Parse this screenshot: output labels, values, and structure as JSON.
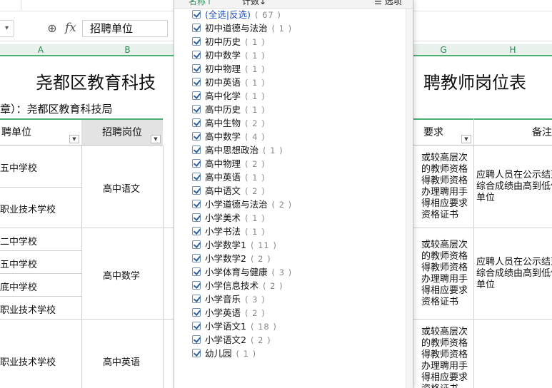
{
  "formula_bar": {
    "cell_value": "招聘单位",
    "fx_label": "fx"
  },
  "columns": [
    "A",
    "B",
    "G",
    "H"
  ],
  "sheet": {
    "title_left": "尧都区教育科技",
    "title_right": "聘教师岗位表",
    "subtitle": "章）：尧都区教育科技局",
    "headers": {
      "unit": "聘单位",
      "position": "招聘岗位",
      "requirements": "要求",
      "notes": "备注"
    },
    "rows": [
      {
        "units": [
          "五中学校",
          "职业技术学校"
        ],
        "position": "高中语文"
      },
      {
        "units": [
          "二中学校",
          "五中学校",
          "底中学校",
          "职业技术学校"
        ],
        "position": "高中数学"
      },
      {
        "units": [
          "职业技术学校"
        ],
        "position": "高中英语"
      }
    ],
    "requirement_text": "或较高层次\n的教师资格\n得教师资格\n办理聘用手\n得相应要求\n资格证书",
    "requirement_text_3": "或较高层次\n的教师资格\n得教师资格\n办理聘用手\n得相应要求\n资格证书",
    "notes_text": "应聘人员在公示结束\n综合成绩由高到低依\n单位"
  },
  "filter_popup": {
    "header_left": "名称↑",
    "header_mid": "计数↓",
    "header_right": "选项",
    "select_all_label": "(全选|反选)",
    "select_all_count": "( 67 )",
    "items": [
      {
        "label": "初中道德与法治",
        "count": "( 1 )"
      },
      {
        "label": "初中历史",
        "count": "( 1 )"
      },
      {
        "label": "初中数学",
        "count": "( 1 )"
      },
      {
        "label": "初中物理",
        "count": "( 1 )"
      },
      {
        "label": "初中英语",
        "count": "( 1 )"
      },
      {
        "label": "高中化学",
        "count": "( 1 )"
      },
      {
        "label": "高中历史",
        "count": "( 1 )"
      },
      {
        "label": "高中生物",
        "count": "( 2 )"
      },
      {
        "label": "高中数学",
        "count": "( 4 )"
      },
      {
        "label": "高中思想政治",
        "count": "( 1 )"
      },
      {
        "label": "高中物理",
        "count": "( 2 )"
      },
      {
        "label": "高中英语",
        "count": "( 1 )"
      },
      {
        "label": "高中语文",
        "count": "( 2 )"
      },
      {
        "label": "小学道德与法治",
        "count": "( 2 )"
      },
      {
        "label": "小学美术",
        "count": "( 1 )"
      },
      {
        "label": "小学书法",
        "count": "( 1 )"
      },
      {
        "label": "小学数学1",
        "count": "( 11 )"
      },
      {
        "label": "小学数学2",
        "count": "( 2 )"
      },
      {
        "label": "小学体育与健康",
        "count": "( 3 )"
      },
      {
        "label": "小学信息技术",
        "count": "( 2 )"
      },
      {
        "label": "小学音乐",
        "count": "( 3 )"
      },
      {
        "label": "小学英语",
        "count": "( 2 )"
      },
      {
        "label": "小学语文1",
        "count": "( 18 )"
      },
      {
        "label": "小学语文2",
        "count": "( 2 )"
      },
      {
        "label": "幼儿园",
        "count": "( 1 )"
      }
    ]
  }
}
